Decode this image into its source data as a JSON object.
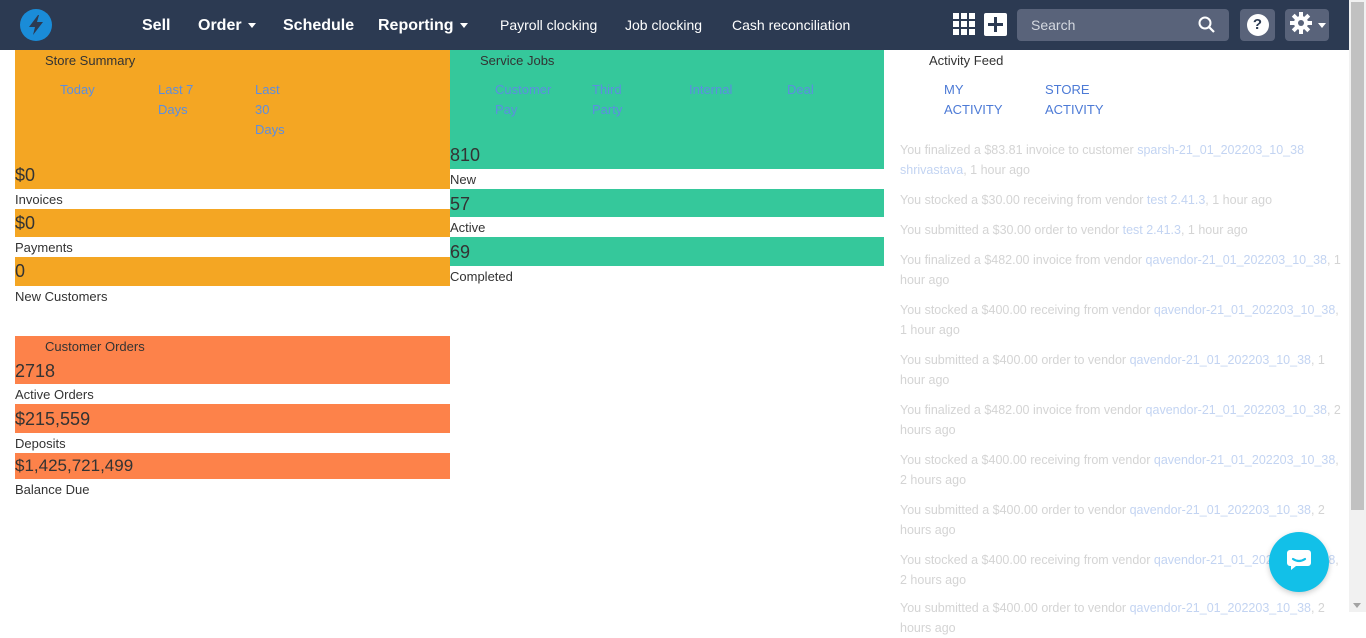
{
  "nav": {
    "main": [
      "Sell",
      "Order",
      "Schedule",
      "Reporting"
    ],
    "sub": [
      "Payroll clocking",
      "Job clocking",
      "Cash reconciliation"
    ],
    "search_placeholder": "Search",
    "help": "?"
  },
  "store_summary": {
    "title": "Store Summary",
    "tabs": [
      "Today",
      "Last 7 Days",
      "Last 30 Days"
    ],
    "metrics": [
      {
        "value": "$0",
        "label": "Invoices"
      },
      {
        "value": "$0",
        "label": "Payments"
      },
      {
        "value": "0",
        "label": "New Customers"
      }
    ]
  },
  "service_jobs": {
    "title": "Service Jobs",
    "tabs": [
      "Customer Pay",
      "Third Party",
      "Internal",
      "Deal"
    ],
    "metrics": [
      {
        "value": "810",
        "label": "New"
      },
      {
        "value": "57",
        "label": "Active"
      },
      {
        "value": "69",
        "label": "Completed"
      }
    ]
  },
  "customer_orders": {
    "title": "Customer Orders",
    "metrics": [
      {
        "value": "2718",
        "label": "Active Orders"
      },
      {
        "value": "$215,559",
        "label": "Deposits"
      },
      {
        "value": "$1,425,721,499",
        "label": "Balance Due"
      }
    ]
  },
  "activity_feed": {
    "title": "Activity Feed",
    "tabs": [
      "MY ACTIVITY",
      "STORE ACTIVITY"
    ],
    "items": [
      {
        "pre": "You finalized a $83.81 invoice to customer ",
        "link": "sparsh-21_01_202203_10_38 shrivastava",
        "post": ", 1 hour ago"
      },
      {
        "pre": "You stocked a $30.00 receiving from vendor ",
        "link": "test 2.41.3",
        "post": ", 1 hour ago"
      },
      {
        "pre": "You submitted a $30.00 order to vendor ",
        "link": "test 2.41.3",
        "post": ", 1 hour ago"
      },
      {
        "pre": "You finalized a $482.00 invoice from vendor ",
        "link": "qavendor-21_01_202203_10_38",
        "post": ", 1 hour ago"
      },
      {
        "pre": "You stocked a $400.00 receiving from vendor ",
        "link": "qavendor-21_01_202203_10_38",
        "post": ", 1 hour ago"
      },
      {
        "pre": "You submitted a $400.00 order to vendor ",
        "link": "qavendor-21_01_202203_10_38",
        "post": ", 1 hour ago"
      },
      {
        "pre": "You finalized a $482.00 invoice from vendor ",
        "link": "qavendor-21_01_202203_10_38",
        "post": ", 2 hours ago"
      },
      {
        "pre": "You stocked a $400.00 receiving from vendor ",
        "link": "qavendor-21_01_202203_10_38",
        "post": ", 2 hours ago"
      },
      {
        "pre": "You submitted a $400.00 order to vendor ",
        "link": "qavendor-21_01_202203_10_38",
        "post": ", 2 hours ago"
      },
      {
        "pre": "You stocked a $400.00 receiving from vendor ",
        "link": "qavendor-21_01_202203_10_38",
        "post": ", 2 hours ago"
      },
      {
        "pre": "You submitted a $400.00 order to vendor ",
        "link": "qavendor-21_01_202203_10_38",
        "post": ", 2 hours ago"
      }
    ]
  },
  "colors": {
    "navbar": "#2c3a52",
    "store_summary": "#f4a623",
    "service_jobs": "#35c89b",
    "customer_orders": "#fd824a",
    "link": "#5c8ee0",
    "chat": "#12c0e8"
  },
  "icons": [
    "bolt-logo-icon",
    "grid-apps-icon",
    "plus-icon",
    "search-icon",
    "help-icon",
    "gear-icon",
    "chat-icon"
  ]
}
